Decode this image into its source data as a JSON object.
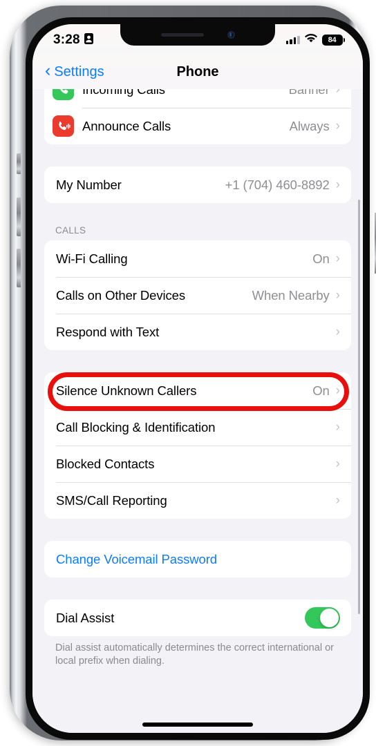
{
  "status_bar": {
    "time": "3:28",
    "contact_icon": "contact-card-icon",
    "signal_icon": "cellular-signal-icon",
    "signal_bars_filled": 3,
    "signal_bars_total": 4,
    "wifi_icon": "wifi-icon",
    "battery_level": "84"
  },
  "nav": {
    "back_label": "Settings",
    "back_chevron": "‹",
    "title": "Phone"
  },
  "colors": {
    "accent_blue": "#0a7cff",
    "toggle_green": "#34c759",
    "icon_green": "#34c759",
    "icon_red": "#ea3b2e",
    "annotation_red": "#e8100c",
    "value_gray": "#8e8e93",
    "page_bg": "#f2f2f7"
  },
  "sections": {
    "notifications": {
      "rows": [
        {
          "label": "Incoming Calls",
          "value": "Banner",
          "icon": "phone-green-icon",
          "chevron": "›"
        },
        {
          "label": "Announce Calls",
          "value": "Always",
          "icon": "announce-calls-icon",
          "chevron": "›"
        }
      ]
    },
    "my_number": {
      "rows": [
        {
          "label": "My Number",
          "value": "+1 (704) 460-8892",
          "chevron": "›"
        }
      ]
    },
    "calls": {
      "header": "CALLS",
      "rows": [
        {
          "label": "Wi-Fi Calling",
          "value": "On",
          "chevron": "›"
        },
        {
          "label": "Calls on Other Devices",
          "value": "When Nearby",
          "chevron": "›"
        },
        {
          "label": "Respond with Text",
          "value": "",
          "chevron": "›"
        }
      ]
    },
    "blocking": {
      "rows": [
        {
          "label": "Silence Unknown Callers",
          "value": "On",
          "chevron": "›"
        },
        {
          "label": "Call Blocking & Identification",
          "value": "",
          "chevron": "›",
          "highlighted": true
        },
        {
          "label": "Blocked Contacts",
          "value": "",
          "chevron": "›"
        },
        {
          "label": "SMS/Call Reporting",
          "value": "",
          "chevron": "›"
        }
      ]
    },
    "voicemail": {
      "rows": [
        {
          "label": "Change Voicemail Password"
        }
      ]
    },
    "dial_assist": {
      "rows": [
        {
          "label": "Dial Assist",
          "toggle_on": true
        }
      ],
      "footer": "Dial assist automatically determines the correct international or local prefix when dialing."
    }
  }
}
